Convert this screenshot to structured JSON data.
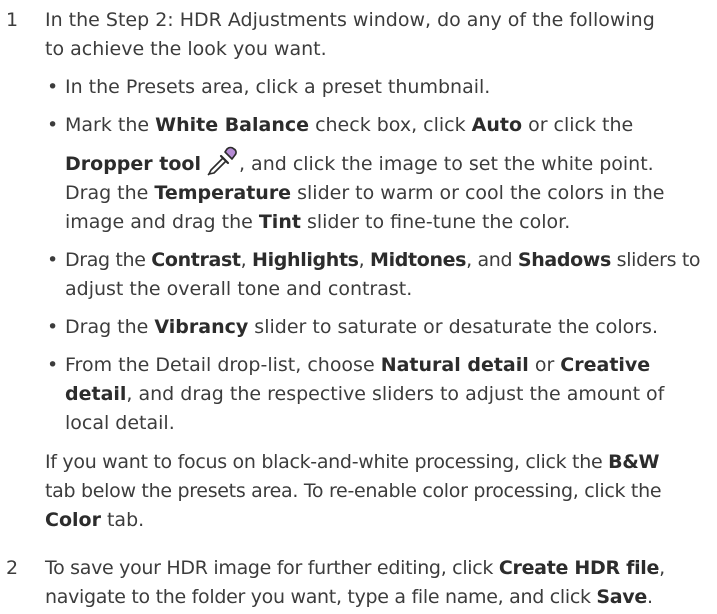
{
  "step1": {
    "number": "1",
    "intro": [
      "In the Step 2: HDR Adjustments window, do any of the following",
      "to achieve the look you want."
    ],
    "bullets": {
      "presets": "In the Presets area, click a preset thumbnail.",
      "wb": {
        "t1": "Mark the ",
        "b1": "White Balance",
        "t2": " check box, click ",
        "b2": "Auto",
        "t3": " or click the",
        "b3": "Dropper tool",
        "t4": ", and click the image to set the white point.",
        "t5": "Drag the ",
        "b4": "Temperature",
        "t6": " slider to warm or cool the colors in the",
        "t7": "image and drag the ",
        "b5": "Tint",
        "t8": " slider to fine-tune the color."
      },
      "tone": {
        "t1": "Drag the ",
        "b1": "Contrast",
        "t2": ", ",
        "b2": "Highlights",
        "t3": ", ",
        "b3": "Midtones",
        "t4": ", and ",
        "b4": "Shadows",
        "t5": " sliders to",
        "t6": "adjust the overall tone and contrast."
      },
      "vibrancy": {
        "t1": "Drag the ",
        "b1": "Vibrancy",
        "t2": " slider to saturate or desaturate the colors."
      },
      "detail": {
        "t1": "From the Detail drop-list, choose ",
        "b1": "Natural detail",
        "t2": " or ",
        "b2": "Creative",
        "b3": "detail",
        "t3": ", and drag the respective sliders to adjust the amount of",
        "t4": "local detail."
      }
    },
    "note": {
      "t1": "If you want to focus on black-and-white processing, click the ",
      "b1": "B&W",
      "t2": "tab below the presets area. To re-enable color processing, click the",
      "b2": "Color",
      "t3": " tab."
    }
  },
  "step2": {
    "number": "2",
    "t1": "To save your HDR image for further editing, click ",
    "b1": "Create HDR file",
    "t2": ",",
    "t3": "navigate to the folder you want, type a file name, and click ",
    "b2": "Save",
    "t4": "."
  },
  "icons": {
    "bullet": "•",
    "dropper": "dropper-icon"
  }
}
